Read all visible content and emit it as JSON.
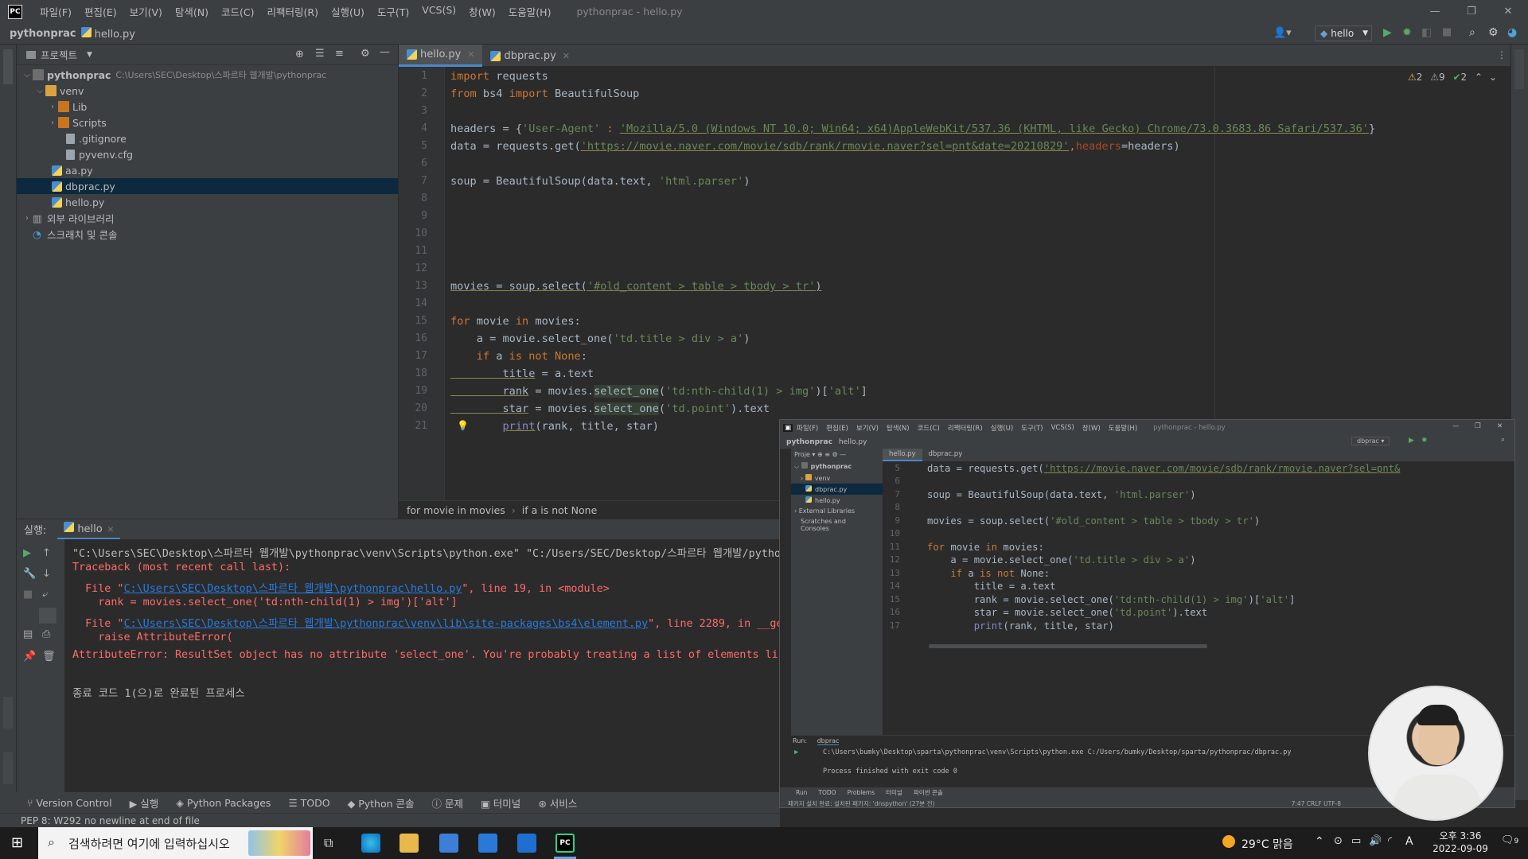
{
  "app": {
    "logo": "PC",
    "menu": [
      "파일(F)",
      "편집(E)",
      "보기(V)",
      "탐색(N)",
      "코드(C)",
      "리팩터링(R)",
      "실행(U)",
      "도구(T)",
      "VCS(S)",
      "창(W)",
      "도움말(H)"
    ],
    "window_title": "pythonprac - hello.py",
    "project_name": "pythonprac",
    "current_file": "hello.py",
    "run_config": "hello"
  },
  "project_panel": {
    "title": "프로젝트",
    "root_name": "pythonprac",
    "root_path": "C:\\Users\\SEC\\Desktop\\스파르타 웹개발\\pythonprac",
    "items": [
      "venv",
      "Lib",
      "Scripts",
      ".gitignore",
      "pyvenv.cfg",
      "aa.py",
      "dbprac.py",
      "hello.py",
      "외부 라이브러리",
      "스크래치 및 콘솔"
    ]
  },
  "editor": {
    "tabs": [
      "hello.py",
      "dbprac.py"
    ],
    "inspections": {
      "warnings": "2",
      "weak": "9",
      "ok": "2"
    },
    "breadcrumb": [
      "for movie in movies",
      "if a is not None"
    ]
  },
  "code": {
    "l1_kw": "import",
    "l1_rest": " requests",
    "l2_kw1": "from",
    "l2_mid": " bs4 ",
    "l2_kw2": "import",
    "l2_rest": " BeautifulSoup",
    "l4_a": "headers = {",
    "l4_s1": "'User-Agent'",
    "l4_b": " : ",
    "l4_s2": "'Mozilla/5.0 (Windows NT 10.0; Win64; x64)AppleWebKit/537.36 (KHTML, like Gecko) Chrome/73.0.3683.86 Safari/537.36'",
    "l4_c": "}",
    "l5_a": "data = requests.get(",
    "l5_url": "'https://movie.naver.com/movie/sdb/rank/rmovie.naver?sel=pnt&date=20210829'",
    "l5_b": ",",
    "l5_kw": "headers",
    "l5_c": "=headers)",
    "l7_a": "soup = BeautifulSoup(data.text, ",
    "l7_s": "'html.parser'",
    "l7_b": ")",
    "l13_a": "movies = soup.select(",
    "l13_s": "'#old_content > table > tbody > tr'",
    "l13_b": ")",
    "l15_kw1": "for",
    "l15_a": " movie ",
    "l15_kw2": "in",
    "l15_b": " movies:",
    "l16_a": "    a = movie.select_one(",
    "l16_s": "'td.title > div > a'",
    "l16_b": ")",
    "l17_kw1": "    if",
    "l17_a": " a ",
    "l17_kw2": "is not",
    "l17_b": " None",
    "l17_c": ":",
    "l18_a": "        title",
    "l18_b": " = a.text",
    "l19_a": "        rank",
    "l19_b": " = movies.",
    "l19_h": "select_one",
    "l19_c": "(",
    "l19_s": "'td:nth-child(1) > img'",
    "l19_d": ")[",
    "l19_s2": "'alt'",
    "l19_e": "]",
    "l20_a": "        star",
    "l20_b": " = movies.",
    "l20_h": "select_one",
    "l20_c": "(",
    "l20_s": "'td.point'",
    "l20_d": ").text",
    "l21_a": "        ",
    "l21_fn": "print",
    "l21_b": "(rank, title, star)"
  },
  "run": {
    "label": "실행:",
    "tab": "hello",
    "out1": "\"C:\\Users\\SEC\\Desktop\\스파르타 웹개발\\pythonprac\\venv\\Scripts\\python.exe\" \"C:/Users/SEC/Desktop/스파르타 웹개발/pytho",
    "out2": "Traceback (most recent call last):",
    "out3_a": "  File \"",
    "out3_link": "C:\\Users\\SEC\\Desktop\\스파르타 웹개발\\pythonprac\\hello.py",
    "out3_b": "\", line 19, in <module>",
    "out4": "    rank = movies.select_one('td:nth-child(1) > img')['alt']",
    "out5_a": "  File \"",
    "out5_link": "C:\\Users\\SEC\\Desktop\\스파르타 웹개발\\pythonprac\\venv\\lib\\site-packages\\bs4\\element.py",
    "out5_b": "\", line 2289, in __ge",
    "out6": "    raise AttributeError(",
    "out7": "AttributeError: ResultSet object has no attribute 'select_one'. You're probably treating a list of elements lik",
    "out8": "종료 코드 1(으)로 완료된 프로세스"
  },
  "bottom_tools": [
    "Version Control",
    "실행",
    "Python Packages",
    "TODO",
    "Python 콘솔",
    "문제",
    "터미널",
    "서비스"
  ],
  "status": "PEP 8: W292 no newline at end of file",
  "inset": {
    "menu": [
      "파일(F)",
      "편집(E)",
      "보기(V)",
      "탐색(N)",
      "코드(C)",
      "리팩터링(R)",
      "실행(U)",
      "도구(T)",
      "VCS(S)",
      "창(W)",
      "도움말(H)"
    ],
    "title": "pythonprac - hello.py",
    "project": "pythonprac",
    "file": "hello.py",
    "run_config": "dbprac",
    "proj_label": "Proje",
    "tree": [
      "pythonprac",
      "venv",
      "dbprac.py",
      "hello.py",
      "External Libraries",
      "Scratches and Consoles"
    ],
    "tabs": [
      "hello.py",
      "dbprac.py"
    ],
    "lines": [
      "5",
      "6",
      "7",
      "8",
      "9",
      "10",
      "11",
      "12",
      "13",
      "14",
      "15",
      "16",
      "17"
    ],
    "c5_a": "data = requests.get(",
    "c5_url": "'https://movie.naver.com/movie/sdb/rank/rmovie.naver?sel=pnt&",
    "c7_a": "soup = BeautifulSoup(data.text, ",
    "c7_s": "'html.parser'",
    "c7_b": ")",
    "c9_a": "movies = soup.select(",
    "c9_s": "'#old_content > table > tbody > tr'",
    "c9_b": ")",
    "c11_kw": "for",
    "c11_a": " movie ",
    "c11_kw2": "in",
    "c11_b": " movies:",
    "c12_a": "    a = movie.select_one(",
    "c12_s": "'td.title > div > a'",
    "c12_b": ")",
    "c13_kw": "    if",
    "c13_a": " a ",
    "c13_kw2": "is not",
    "c13_b": " None:",
    "c14": "        title = a.text",
    "c15_a": "        rank = movie.select_one(",
    "c15_s": "'td:nth-child(1) > img'",
    "c15_b": ")[",
    "c15_s2": "'alt'",
    "c15_c": "]",
    "c16_a": "        star = movie.select_one(",
    "c16_s": "'td.point'",
    "c16_b": ").text",
    "c17_a": "        print",
    "c17_b": "(rank, title, star)",
    "run_label": "Run:",
    "run_tab": "dbprac",
    "run_out1": "C:\\Users\\bumky\\Desktop\\sparta\\pythonprac\\venv\\Scripts\\python.exe C:/Users/bumky/Desktop/sparta/pythonprac/dbprac.py",
    "run_out2": "Process finished with exit code 0",
    "tools": [
      "Run",
      "TODO",
      "Problems",
      "터미널",
      "파이썬 콘솔"
    ],
    "status": "패키지 설치 완료: 설치된 패키지: 'dnspython' (27분 전)",
    "status_right": "7:47   CRLF   UTF-8"
  },
  "taskbar": {
    "search_placeholder": "검색하려면 여기에 입력하십시오",
    "weather": "29°C 맑음",
    "time": "오후 3:36",
    "date": "2022-09-09",
    "notif": "9",
    "ime": "A"
  }
}
